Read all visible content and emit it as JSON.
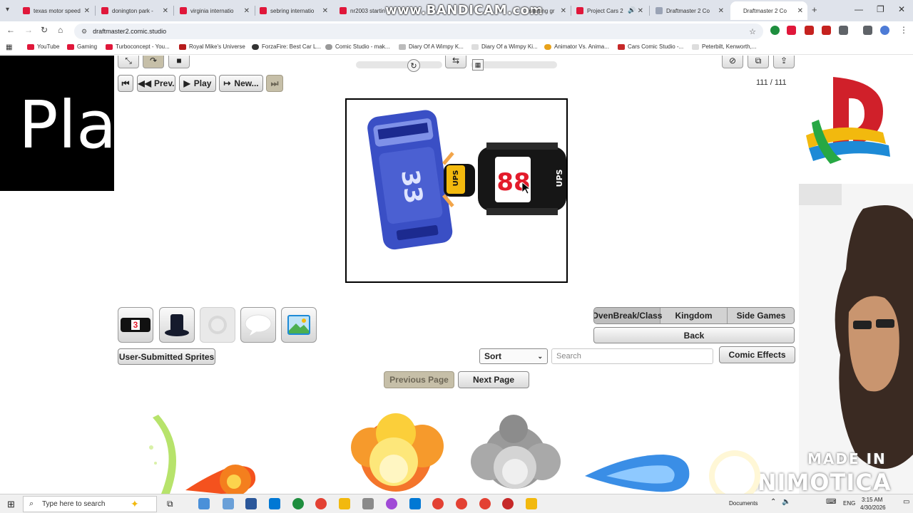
{
  "browser": {
    "tabs": [
      {
        "label": "texas motor speed",
        "color": "#e0173a"
      },
      {
        "label": "donington park -",
        "color": "#e0173a"
      },
      {
        "label": "virginia internatio",
        "color": "#e0173a"
      },
      {
        "label": "sebring internatio",
        "color": "#e0173a"
      },
      {
        "label": "nr2003 startin",
        "color": "#e0173a"
      },
      {
        "label": "starting gr",
        "color": "#e0173a"
      },
      {
        "label": "Project Cars 2",
        "color": "#e0173a"
      },
      {
        "label": "Draftmaster 2 Co",
        "color": "#9aa3b5"
      },
      {
        "label": "Draftmaster 2 Co",
        "color": "#9aa3b5"
      }
    ],
    "recorder_watermark": "www.BANDICAM.com",
    "url": "draftmaster2.comic.studio",
    "bookmarks": [
      "YouTube",
      "Gaming",
      "Turboconcept - You...",
      "Royal Mike's Universe",
      "ForzaFire: Best Car L...",
      "Comic Studio - mak...",
      "Diary Of A Wimpy K...",
      "Diary Of a Wimpy Ki...",
      "Animator Vs. Anima...",
      "Cars Comic Studio -...",
      "Peterbilt, Kenworth,..."
    ]
  },
  "editor": {
    "playback": {
      "prev_label": "Prev.",
      "play_label": "Play",
      "new_label": "New...",
      "frame_counter": "111 / 111"
    },
    "canvas": {
      "left_car_number": "33",
      "right_car_number": "88",
      "right_car_sponsor": "UPS"
    },
    "category_tabs": {
      "tab1": "OvenBreak/Class",
      "tab2": "Kingdom",
      "tab3": "Side Games",
      "back_label": "Back"
    },
    "user_sprites_label": "User-Submitted Sprites",
    "sort": {
      "selected": "Sort"
    },
    "search": {
      "placeholder": "Search"
    },
    "comic_effects_label": "Comic Effects",
    "pagination": {
      "previous_label": "Previous Page",
      "next_label": "Next Page"
    },
    "sprite_tile_badge": "3"
  },
  "overlays": {
    "left_text": "Pla",
    "animotica_line1": "MADE IN",
    "animotica_line2": "ANIMOTICA"
  },
  "taskbar": {
    "search_placeholder": "Type here to search",
    "documents_label": "Documents",
    "language": "ENG",
    "time": "3:15 AM",
    "date": "4/30/2026"
  }
}
